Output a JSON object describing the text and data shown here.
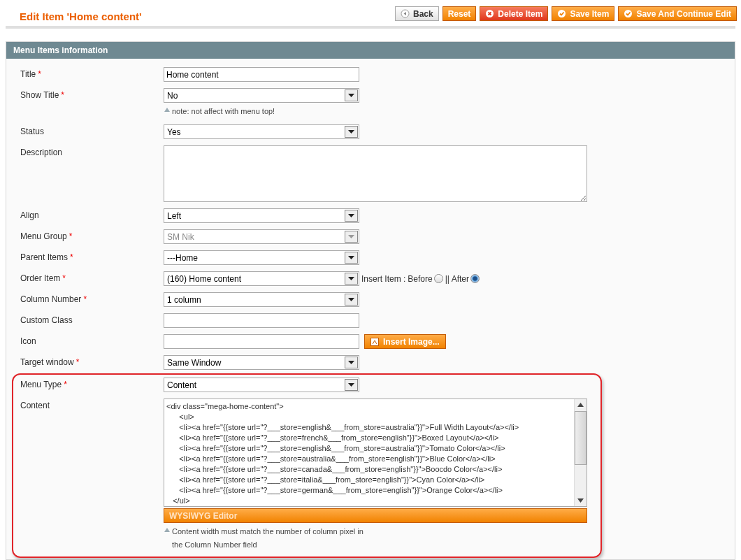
{
  "header": {
    "title": "Edit Item 'Home content'",
    "buttons": [
      {
        "label": "Back",
        "kind": "back"
      },
      {
        "label": "Reset",
        "kind": "plain"
      },
      {
        "label": "Delete Item",
        "kind": "delete"
      },
      {
        "label": "Save Item",
        "kind": "save"
      },
      {
        "label": "Save And Continue Edit",
        "kind": "save"
      }
    ]
  },
  "section": {
    "title": "Menu Items information"
  },
  "fields": [
    {
      "label": "Title",
      "required_mark": "*",
      "kind": "text",
      "value": "Home content"
    },
    {
      "label": "Show Title",
      "required_mark": "*",
      "kind": "select",
      "value": "No",
      "disabled": false,
      "note": "note: not affect with menu top!"
    },
    {
      "label": "Status",
      "kind": "select",
      "value": "Yes",
      "disabled": false
    },
    {
      "label": "Description",
      "kind": "textarea"
    },
    {
      "label": "Align",
      "kind": "select",
      "value": "Left",
      "disabled": false
    },
    {
      "label": "Menu Group",
      "required_mark": "*",
      "kind": "select",
      "value": "SM Nik",
      "disabled": true
    },
    {
      "label": "Parent Items",
      "required_mark": "*",
      "kind": "select",
      "value": "---Home",
      "disabled": false
    },
    {
      "label": "Order Item",
      "required_mark": "*",
      "kind": "select",
      "value": "(160) Home content",
      "disabled": false,
      "insert": {
        "label": "Insert Item :",
        "options": [
          {
            "label": "Before",
            "selected": false
          },
          {
            "label": "|| After",
            "selected": true
          }
        ]
      }
    },
    {
      "label": "Column Number",
      "required_mark": "*",
      "kind": "select",
      "value": "1 column",
      "disabled": false
    },
    {
      "label": "Custom Class",
      "kind": "text"
    },
    {
      "label": "Icon",
      "kind": "text",
      "button": "Insert Image..."
    },
    {
      "label": "Target window",
      "required_mark": "*",
      "kind": "select",
      "value": "Same Window",
      "disabled": false
    },
    {
      "label": "Menu Type",
      "required_mark": "*",
      "kind": "select",
      "value": "Content",
      "disabled": false,
      "highlighted": true
    },
    {
      "label": "Content",
      "kind": "code",
      "highlighted": true,
      "lines": [
        "<div class=\"mega-home-content\">",
        "      <ul>",
        "      <li><a href=\"{{store url=\"?___store=english&___from_store=australia\"}}\">Full Width Layout</a></li>",
        "      <li><a href=\"{{store url=\"?___store=french&___from_store=english\"}}\">Boxed Layout</a></li>",
        "      <li><a href=\"{{store url=\"?___store=english&___from_store=australia\"}}\">Tomato Color</a></li>",
        "      <li><a href=\"{{store url=\"?___store=australia&___from_store=english\"}}\">Blue Color</a></li>",
        "      <li><a href=\"{{store url=\"?___store=canada&___from_store=english\"}}\">Boocdo Color</a></li>",
        "      <li><a href=\"{{store url=\"?___store=italia&___from_store=english\"}}\">Cyan Color</a></li>",
        "      <li><a href=\"{{store url=\"?___store=german&___from_store=english\"}}\">Orange Color</a></li>",
        "   </ul>"
      ],
      "button": "WYSIWYG Editor",
      "note": "Content width must match the number of column pixel in the Column Number field"
    }
  ]
}
